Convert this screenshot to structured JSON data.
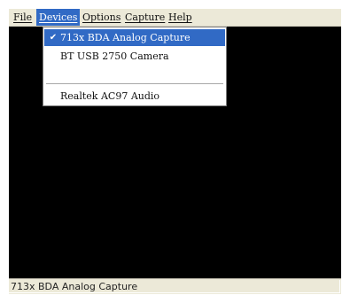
{
  "menubar": {
    "items": [
      {
        "label": "File"
      },
      {
        "label": "Devices",
        "active": true
      },
      {
        "label": "Options"
      },
      {
        "label": "Capture"
      },
      {
        "label": "Help"
      }
    ]
  },
  "devices_menu": {
    "items": [
      {
        "label": "713x BDA Analog Capture",
        "checked": true,
        "selected": true
      },
      {
        "label": "BT USB 2750 Camera",
        "checked": false
      },
      {
        "label": "Realtek AC97 Audio",
        "checked": false
      }
    ],
    "check_glyph": "✔"
  },
  "video": {
    "background": "#000000"
  },
  "statusbar": {
    "text": "713x BDA Analog Capture"
  },
  "colors": {
    "accent": "#316ac5",
    "chrome": "#ece9d8"
  }
}
